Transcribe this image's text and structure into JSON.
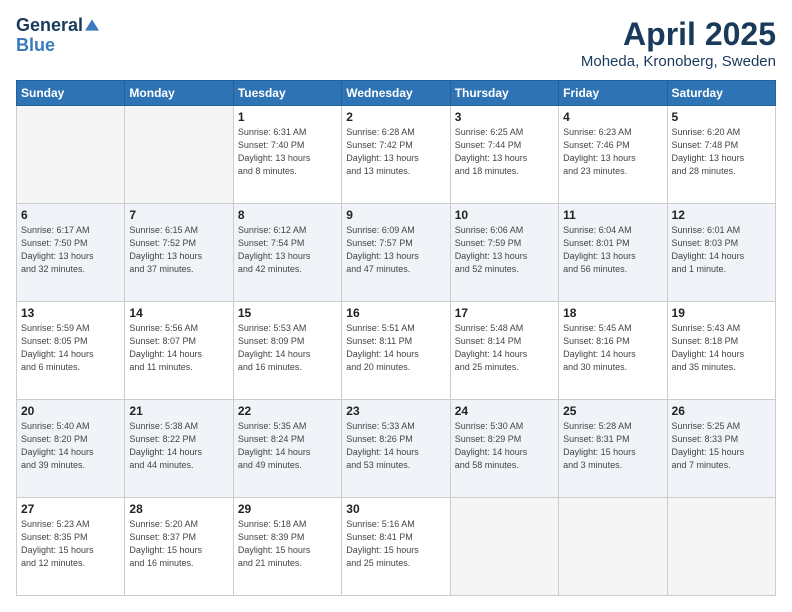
{
  "logo": {
    "line1": "General",
    "line2": "Blue"
  },
  "title": "April 2025",
  "location": "Moheda, Kronoberg, Sweden",
  "days_header": [
    "Sunday",
    "Monday",
    "Tuesday",
    "Wednesday",
    "Thursday",
    "Friday",
    "Saturday"
  ],
  "weeks": [
    [
      {
        "day": "",
        "info": ""
      },
      {
        "day": "",
        "info": ""
      },
      {
        "day": "1",
        "info": "Sunrise: 6:31 AM\nSunset: 7:40 PM\nDaylight: 13 hours\nand 8 minutes."
      },
      {
        "day": "2",
        "info": "Sunrise: 6:28 AM\nSunset: 7:42 PM\nDaylight: 13 hours\nand 13 minutes."
      },
      {
        "day": "3",
        "info": "Sunrise: 6:25 AM\nSunset: 7:44 PM\nDaylight: 13 hours\nand 18 minutes."
      },
      {
        "day": "4",
        "info": "Sunrise: 6:23 AM\nSunset: 7:46 PM\nDaylight: 13 hours\nand 23 minutes."
      },
      {
        "day": "5",
        "info": "Sunrise: 6:20 AM\nSunset: 7:48 PM\nDaylight: 13 hours\nand 28 minutes."
      }
    ],
    [
      {
        "day": "6",
        "info": "Sunrise: 6:17 AM\nSunset: 7:50 PM\nDaylight: 13 hours\nand 32 minutes."
      },
      {
        "day": "7",
        "info": "Sunrise: 6:15 AM\nSunset: 7:52 PM\nDaylight: 13 hours\nand 37 minutes."
      },
      {
        "day": "8",
        "info": "Sunrise: 6:12 AM\nSunset: 7:54 PM\nDaylight: 13 hours\nand 42 minutes."
      },
      {
        "day": "9",
        "info": "Sunrise: 6:09 AM\nSunset: 7:57 PM\nDaylight: 13 hours\nand 47 minutes."
      },
      {
        "day": "10",
        "info": "Sunrise: 6:06 AM\nSunset: 7:59 PM\nDaylight: 13 hours\nand 52 minutes."
      },
      {
        "day": "11",
        "info": "Sunrise: 6:04 AM\nSunset: 8:01 PM\nDaylight: 13 hours\nand 56 minutes."
      },
      {
        "day": "12",
        "info": "Sunrise: 6:01 AM\nSunset: 8:03 PM\nDaylight: 14 hours\nand 1 minute."
      }
    ],
    [
      {
        "day": "13",
        "info": "Sunrise: 5:59 AM\nSunset: 8:05 PM\nDaylight: 14 hours\nand 6 minutes."
      },
      {
        "day": "14",
        "info": "Sunrise: 5:56 AM\nSunset: 8:07 PM\nDaylight: 14 hours\nand 11 minutes."
      },
      {
        "day": "15",
        "info": "Sunrise: 5:53 AM\nSunset: 8:09 PM\nDaylight: 14 hours\nand 16 minutes."
      },
      {
        "day": "16",
        "info": "Sunrise: 5:51 AM\nSunset: 8:11 PM\nDaylight: 14 hours\nand 20 minutes."
      },
      {
        "day": "17",
        "info": "Sunrise: 5:48 AM\nSunset: 8:14 PM\nDaylight: 14 hours\nand 25 minutes."
      },
      {
        "day": "18",
        "info": "Sunrise: 5:45 AM\nSunset: 8:16 PM\nDaylight: 14 hours\nand 30 minutes."
      },
      {
        "day": "19",
        "info": "Sunrise: 5:43 AM\nSunset: 8:18 PM\nDaylight: 14 hours\nand 35 minutes."
      }
    ],
    [
      {
        "day": "20",
        "info": "Sunrise: 5:40 AM\nSunset: 8:20 PM\nDaylight: 14 hours\nand 39 minutes."
      },
      {
        "day": "21",
        "info": "Sunrise: 5:38 AM\nSunset: 8:22 PM\nDaylight: 14 hours\nand 44 minutes."
      },
      {
        "day": "22",
        "info": "Sunrise: 5:35 AM\nSunset: 8:24 PM\nDaylight: 14 hours\nand 49 minutes."
      },
      {
        "day": "23",
        "info": "Sunrise: 5:33 AM\nSunset: 8:26 PM\nDaylight: 14 hours\nand 53 minutes."
      },
      {
        "day": "24",
        "info": "Sunrise: 5:30 AM\nSunset: 8:29 PM\nDaylight: 14 hours\nand 58 minutes."
      },
      {
        "day": "25",
        "info": "Sunrise: 5:28 AM\nSunset: 8:31 PM\nDaylight: 15 hours\nand 3 minutes."
      },
      {
        "day": "26",
        "info": "Sunrise: 5:25 AM\nSunset: 8:33 PM\nDaylight: 15 hours\nand 7 minutes."
      }
    ],
    [
      {
        "day": "27",
        "info": "Sunrise: 5:23 AM\nSunset: 8:35 PM\nDaylight: 15 hours\nand 12 minutes."
      },
      {
        "day": "28",
        "info": "Sunrise: 5:20 AM\nSunset: 8:37 PM\nDaylight: 15 hours\nand 16 minutes."
      },
      {
        "day": "29",
        "info": "Sunrise: 5:18 AM\nSunset: 8:39 PM\nDaylight: 15 hours\nand 21 minutes."
      },
      {
        "day": "30",
        "info": "Sunrise: 5:16 AM\nSunset: 8:41 PM\nDaylight: 15 hours\nand 25 minutes."
      },
      {
        "day": "",
        "info": ""
      },
      {
        "day": "",
        "info": ""
      },
      {
        "day": "",
        "info": ""
      }
    ]
  ]
}
